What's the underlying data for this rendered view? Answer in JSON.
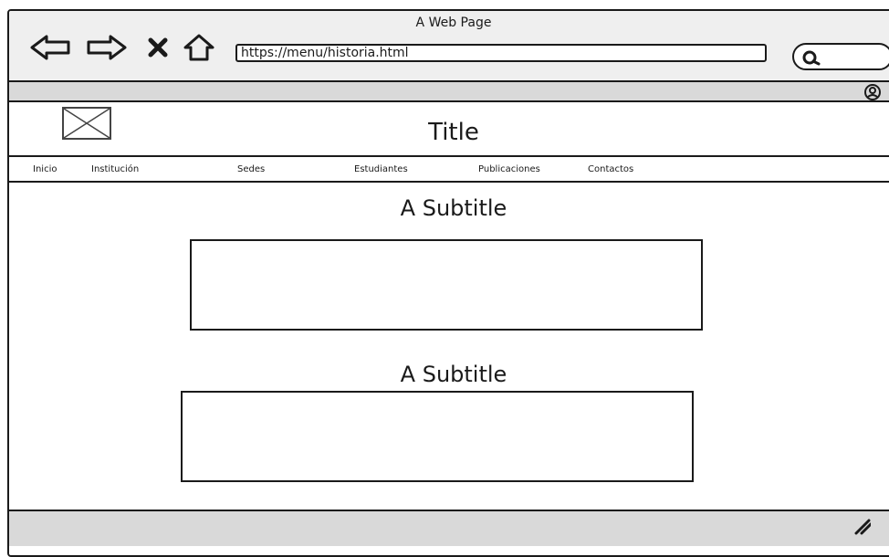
{
  "window": {
    "title": "A Web Page"
  },
  "browser": {
    "url": "https://menu/historia.html",
    "buttons": {
      "back": "back",
      "forward": "forward",
      "stop": "stop",
      "home": "home"
    }
  },
  "icons": {
    "back": "back-arrow-icon",
    "forward": "forward-arrow-icon",
    "stop": "close-icon",
    "home": "home-icon",
    "search": "search-icon",
    "user": "user-icon",
    "logo": "image-placeholder-icon",
    "resize": "resize-grip-icon"
  },
  "header": {
    "title": "Title"
  },
  "menu": {
    "items": [
      {
        "label": "Inicio"
      },
      {
        "label": "Institución"
      },
      {
        "label": "Sedes"
      },
      {
        "label": "Estudiantes"
      },
      {
        "label": "Publicaciones"
      },
      {
        "label": "Contactos"
      }
    ]
  },
  "sections": [
    {
      "subtitle": "A Subtitle"
    },
    {
      "subtitle": "A Subtitle"
    }
  ],
  "colors": {
    "chrome": "#efefef",
    "strip": "#d9d9d9",
    "stroke": "#1a1a1a",
    "background": "#ffffff"
  }
}
